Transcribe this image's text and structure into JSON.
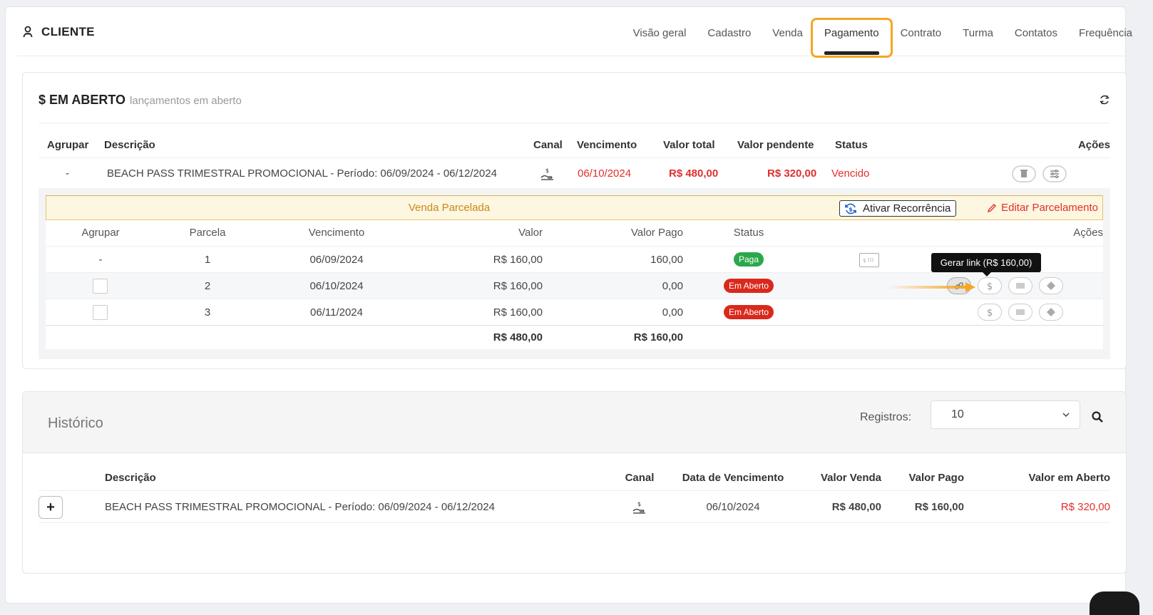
{
  "header": {
    "title": "CLIENTE",
    "tabs": [
      "Visão geral",
      "Cadastro",
      "Venda",
      "Pagamento",
      "Contrato",
      "Turma",
      "Contatos",
      "Frequência"
    ],
    "active_tab": "Pagamento"
  },
  "open": {
    "title": "$ EM ABERTO",
    "subtitle": "lançamentos em aberto",
    "columns": {
      "agrupar": "Agrupar",
      "descricao": "Descrição",
      "canal": "Canal",
      "vencimento": "Vencimento",
      "valor_total": "Valor total",
      "valor_pendente": "Valor pendente",
      "status": "Status",
      "acoes": "Ações"
    },
    "row": {
      "agrupar": "-",
      "descricao": "BEACH PASS TRIMESTRAL PROMOCIONAL - Período: 06/09/2024 - 06/12/2024",
      "vencimento": "06/10/2024",
      "valor_total": "R$ 480,00",
      "valor_pendente": "R$ 320,00",
      "status": "Vencido"
    },
    "installments": {
      "banner": "Venda Parcelada",
      "recurrence_button": "Ativar Recorrência",
      "edit_button": "Editar Parcelamento",
      "columns": {
        "agrupar": "Agrupar",
        "parcela": "Parcela",
        "vencimento": "Vencimento",
        "valor": "Valor",
        "valor_pago": "Valor Pago",
        "status": "Status",
        "acoes": "Ações"
      },
      "rows": [
        {
          "agrupar": "-",
          "parcela": "1",
          "vencimento": "06/09/2024",
          "valor": "R$ 160,00",
          "valor_pago": "160,00",
          "status": "Paga"
        },
        {
          "agrupar": "",
          "parcela": "2",
          "vencimento": "06/10/2024",
          "valor": "R$ 160,00",
          "valor_pago": "0,00",
          "status": "Em Aberto"
        },
        {
          "agrupar": "",
          "parcela": "3",
          "vencimento": "06/11/2024",
          "valor": "R$ 160,00",
          "valor_pago": "0,00",
          "status": "Em Aberto"
        }
      ],
      "total_valor": "R$ 480,00",
      "total_pago": "R$ 160,00",
      "tooltip": "Gerar link (R$ 160,00)"
    }
  },
  "history": {
    "title": "Histórico",
    "registros_label": "Registros:",
    "registros_value": "10",
    "columns": {
      "descricao": "Descrição",
      "canal": "Canal",
      "data_vencimento": "Data de Vencimento",
      "valor_venda": "Valor Venda",
      "valor_pago": "Valor Pago",
      "valor_aberto": "Valor em Aberto"
    },
    "row": {
      "expand": "+",
      "descricao": "BEACH PASS TRIMESTRAL PROMOCIONAL - Período: 06/09/2024 - 06/12/2024",
      "data_vencimento": "06/10/2024",
      "valor_venda": "R$ 480,00",
      "valor_pago": "R$ 160,00",
      "valor_aberto": "R$ 320,00"
    }
  },
  "colors": {
    "highlight": "#f5a623",
    "danger": "#e0302e",
    "success": "#2aa84a",
    "banner_bg": "#fdf6e0"
  },
  "icons": [
    "user-icon",
    "refresh-icon",
    "hand-money-icon",
    "trash-icon",
    "sliders-icon",
    "recurrence-icon",
    "pencil-icon",
    "receipt-icon",
    "link-icon",
    "dollar-icon",
    "barcode-icon",
    "pix-icon",
    "search-icon",
    "chevron-down-icon"
  ]
}
